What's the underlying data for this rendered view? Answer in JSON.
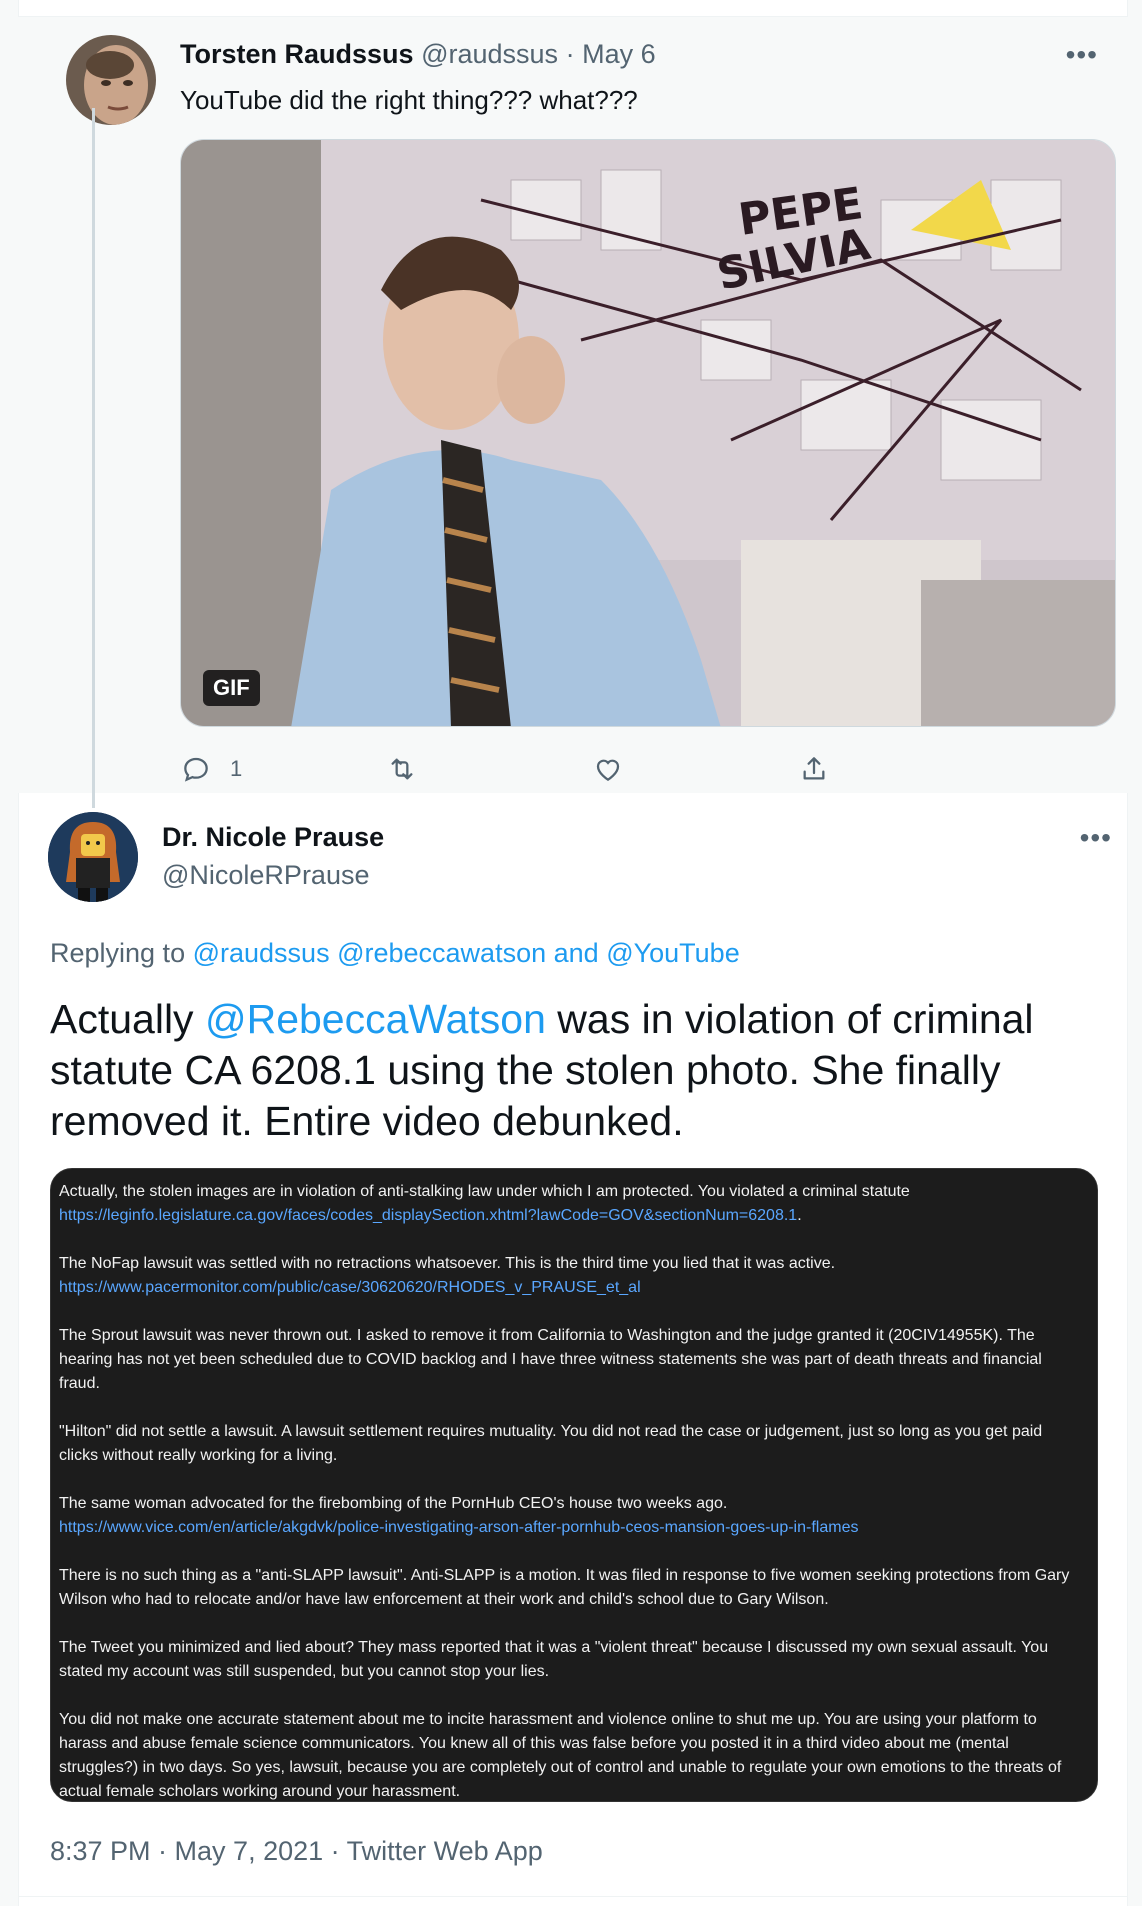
{
  "tweet1": {
    "author_name": "Torsten Raudssus",
    "handle": "@raudssus",
    "date": "May 6",
    "separator": "·",
    "more": "•••",
    "text": "YouTube did the right thing??? what???",
    "media_badge": "GIF",
    "media_caption_text": [
      "PEPE",
      "SILVIA"
    ],
    "reply_count": "1"
  },
  "tweet2": {
    "author_name": "Dr. Nicole Prause",
    "handle": "@NicoleRPrause",
    "more": "•••",
    "replying_prefix": "Replying to",
    "replying_to": [
      "@raudssus",
      "@rebeccawatson",
      "@YouTube"
    ],
    "replying_and": "and",
    "body_prefix": "Actually",
    "body_mention": "@RebeccaWatson",
    "body_rest": "was in violation of criminal statute CA 6208.1 using the stolen photo. She finally removed it. Entire video debunked.",
    "screenshot_paragraphs": [
      {
        "text": "Actually, the stolen images are in violation of anti-stalking law under which I am protected. You violated a criminal statute",
        "url": "https://leginfo.legislature.ca.gov/faces/codes_displaySection.xhtml?lawCode=GOV&sectionNum=6208.1",
        "url_suffix": "."
      },
      {
        "text": "The NoFap lawsuit was settled with no retractions whatsoever. This is the third time you lied that it was active.",
        "url": "https://www.pacermonitor.com/public/case/30620620/RHODES_v_PRAUSE_et_al",
        "url_suffix": ""
      },
      {
        "text": "The Sprout lawsuit was never thrown out. I asked to remove it from California to Washington and the judge granted it (20CIV14955K). The hearing has not yet been scheduled due to COVID backlog and I have three witness statements she was part of death threats and financial fraud.",
        "url": "",
        "url_suffix": ""
      },
      {
        "text": "\"Hilton\" did not settle a lawsuit.  A lawsuit settlement requires mutuality. You did not read the case or judgement, just so long as you get paid clicks without really working for a living.",
        "url": "",
        "url_suffix": ""
      },
      {
        "text": "The same woman advocated for the firebombing of the PornHub CEO's house two weeks ago.",
        "url": "https://www.vice.com/en/article/akgdvk/police-investigating-arson-after-pornhub-ceos-mansion-goes-up-in-flames",
        "url_suffix": ""
      },
      {
        "text": "There is no such thing as a \"anti-SLAPP lawsuit\". Anti-SLAPP is a motion. It was filed in response to five women seeking protections from Gary Wilson who had to relocate and/or have law enforcement at their work and child's school due to Gary Wilson.",
        "url": "",
        "url_suffix": ""
      },
      {
        "text": "The Tweet you minimized and lied about? They mass reported that it was a \"violent threat\" because I discussed my own sexual assault. You stated my account was still suspended, but you cannot stop your lies.",
        "url": "",
        "url_suffix": ""
      },
      {
        "text": "You did not make one accurate statement about me to incite harassment and violence online to shut me up. You are using your platform to harass and abuse female science communicators. You knew all of this was false before you posted it in a third video about me (mental struggles?) in two days.  So yes, lawsuit, because you are completely out of control and unable to regulate your own emotions to the threats of actual female scholars working around your harassment.",
        "url": "",
        "url_suffix": ""
      }
    ],
    "footer": "8:37 PM · May 7, 2021 · Twitter Web App"
  },
  "icons": [
    "reply-icon",
    "retweet-icon",
    "like-icon",
    "share-icon",
    "more-icon"
  ],
  "colors": {
    "link": "#1d9bf0",
    "secondary_text": "#536471",
    "thread_line": "#cfd9de"
  }
}
